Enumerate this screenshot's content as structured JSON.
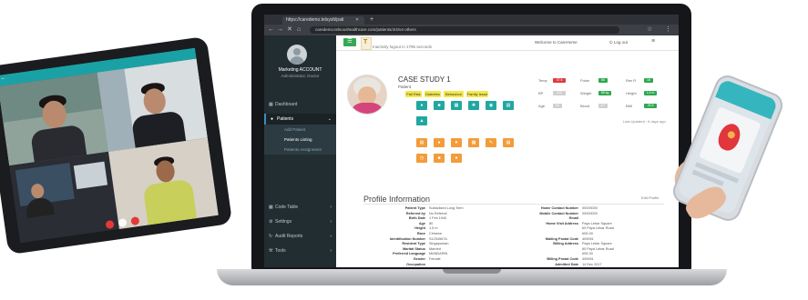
{
  "browser": {
    "tab_title": "https://caredemo.telsyslt/pati",
    "url": "caredemo.telsoushealthcare.com/patients/4/4/v4-others"
  },
  "sidebar": {
    "user_name": "Marketing ACCOUNT",
    "user_role": "Administrator, Doctor",
    "items": [
      {
        "label": "Dashboard"
      },
      {
        "label": "Patients"
      },
      {
        "label": "Code Table"
      },
      {
        "label": "Settings"
      },
      {
        "label": "Audit Reports"
      },
      {
        "label": "Tools"
      }
    ],
    "sub_items": [
      {
        "label": "Add Patient"
      },
      {
        "label": "Patients Listing"
      },
      {
        "label": "Patients Assignment"
      }
    ]
  },
  "header": {
    "logo_text": "T",
    "inactivity": "Inactivity logout in 1795 seconds",
    "welcome": "Welcome to CareHome",
    "logout": "Log out"
  },
  "case": {
    "title": "CASE STUDY 1",
    "patient_label": "Patient",
    "tags": [
      "Fall Risk",
      "Diabetes",
      "Behaviour",
      "Family Issue"
    ],
    "vitals": [
      {
        "label": "Temp",
        "value": "37.5",
        "color": "#e03a3a"
      },
      {
        "label": "BP",
        "value": "120",
        "color": "#cfcfcf"
      },
      {
        "label": "Age",
        "value": "80",
        "color": "#cfcfcf"
      },
      {
        "label": "Pulse",
        "value": "86",
        "color": "#2ea84f"
      },
      {
        "label": "Weight",
        "value": "58 kg",
        "color": "#2ea84f"
      },
      {
        "label": "Blood",
        "value": "O+",
        "color": "#cfcfcf"
      },
      {
        "label": "Res R",
        "value": "18",
        "color": "#2ea84f"
      },
      {
        "label": "Height",
        "value": "1.5 m",
        "color": "#2ea84f"
      },
      {
        "label": "BMI",
        "value": "25.8",
        "color": "#2ea84f"
      }
    ],
    "last_updated": "Last Updated : 6 days ago"
  },
  "profile": {
    "title": "Profile Information",
    "edit_label": "Edit Profile",
    "left": [
      {
        "label": "Patient Type",
        "value": "Subsidized Long Term"
      },
      {
        "label": "Referred by",
        "value": "No Referral"
      },
      {
        "label": "Birth Date",
        "value": "1 Feb 1940"
      },
      {
        "label": "Age",
        "value": "80"
      },
      {
        "label": "Height",
        "value": "1.5 m"
      },
      {
        "label": "Race",
        "value": "Chinese"
      },
      {
        "label": "Identification Number",
        "value": "S1234567A"
      },
      {
        "label": "Resident Type",
        "value": "Singaporean"
      },
      {
        "label": "Marital Status",
        "value": "Married"
      },
      {
        "label": "Preferred Language",
        "value": "MANDARIN"
      },
      {
        "label": "Gender",
        "value": "Female"
      },
      {
        "label": "Occupation",
        "value": ""
      },
      {
        "label": "Blood Type",
        "value": "A+"
      },
      {
        "label": "Religion",
        "value": ""
      },
      {
        "label": "Package Type",
        "value": "Case by Case"
      }
    ],
    "right": [
      {
        "label": "Home Contact Number",
        "value": "00000000"
      },
      {
        "label": "Mobile Contact Number",
        "value": "00000000"
      },
      {
        "label": "Email",
        "value": ""
      },
      {
        "label": "Home Visit Address",
        "value": "Paya Lebar Square"
      },
      {
        "label": "",
        "value": "60 Paya Lebar Road"
      },
      {
        "label": "",
        "value": "#05-00"
      },
      {
        "label": "Mailing Postal Code",
        "value": "409051"
      },
      {
        "label": "Billing Address",
        "value": "Paya Lebar Square"
      },
      {
        "label": "",
        "value": "60 Paya Lebar Road"
      },
      {
        "label": "",
        "value": "#05-00"
      },
      {
        "label": "Billing Postal Code",
        "value": "409051"
      },
      {
        "label": "Admitted Date",
        "value": "14 Dec 2017"
      },
      {
        "label": "Reason of Admission",
        "value": "Stage 3 left hip pressure injury"
      },
      {
        "label": "Discharge Notice Period",
        "value": ""
      },
      {
        "label": "(in months)",
        "value": ""
      }
    ]
  },
  "colors": {
    "sidebar_bg": "#222d32",
    "teal_button": "#20a8a0",
    "orange_button": "#f39c3b",
    "tag_yellow": "#f3e84a",
    "menu_green": "#35a853"
  }
}
